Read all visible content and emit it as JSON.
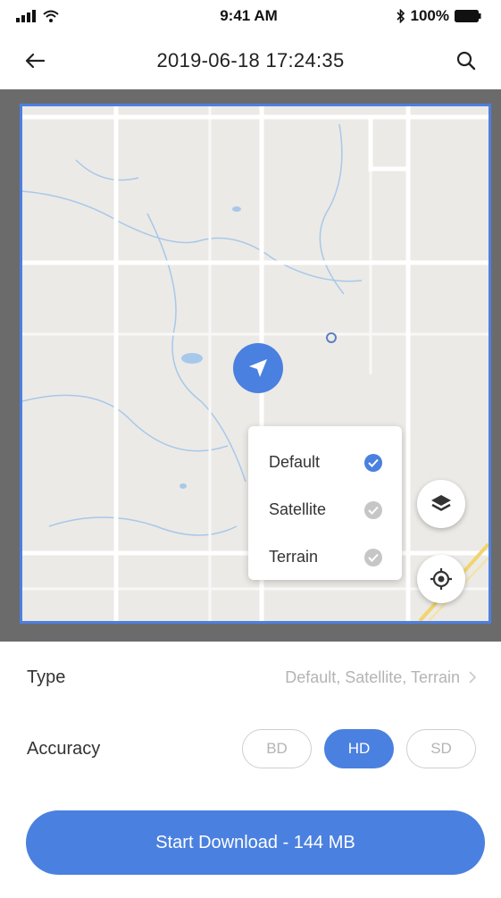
{
  "status_bar": {
    "time": "9:41 AM",
    "battery": "100%"
  },
  "nav": {
    "title": "2019-06-18 17:24:35",
    "back_icon": "arrow-left-icon",
    "search_icon": "search-icon"
  },
  "map": {
    "layer_options": [
      {
        "label": "Default",
        "selected": true
      },
      {
        "label": "Satellite",
        "selected": false
      },
      {
        "label": "Terrain",
        "selected": false
      }
    ],
    "colors": {
      "accent": "#4a80e0",
      "frame": "#6b6b6b",
      "map_bg": "#eceae6",
      "water": "#a7c8ea"
    }
  },
  "settings": {
    "type_label": "Type",
    "type_value": "Default, Satellite, Terrain",
    "accuracy_label": "Accuracy",
    "accuracy_options": [
      {
        "label": "BD",
        "active": false
      },
      {
        "label": "HD",
        "active": true
      },
      {
        "label": "SD",
        "active": false
      }
    ]
  },
  "download_button": {
    "label": "Start Download - 144 MB"
  }
}
